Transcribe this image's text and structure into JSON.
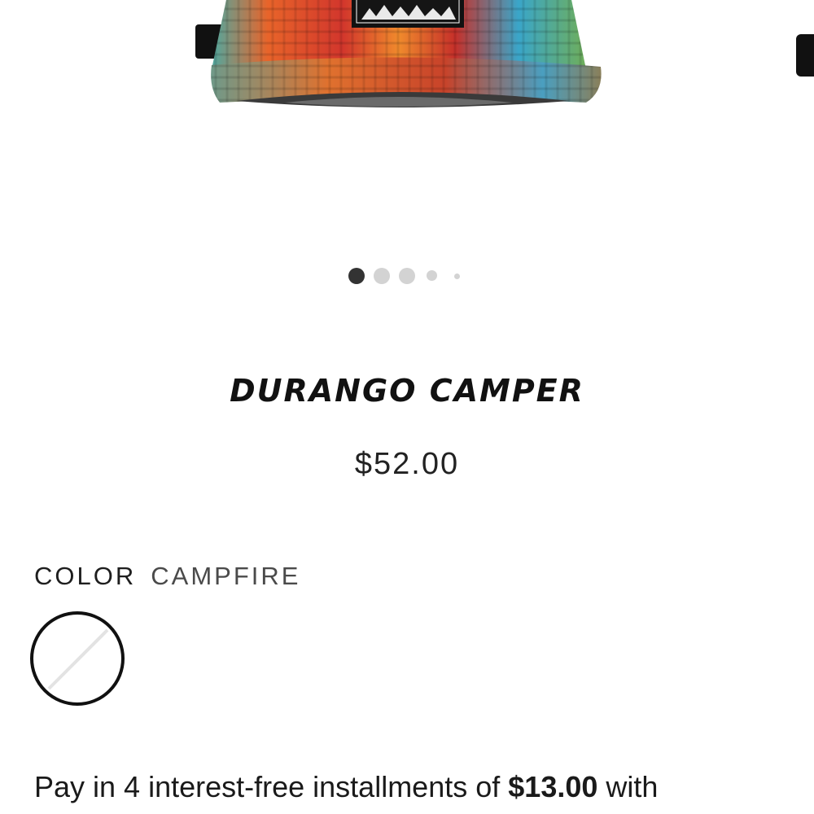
{
  "product": {
    "title": "DURANGO CAMPER",
    "price": "$52.00",
    "hat_image_icon": "plaid-camper-hat-image",
    "gallery_dots_count": 5,
    "gallery_active_index": 0
  },
  "color": {
    "label": "COLOR",
    "selected": "CAMPFIRE"
  },
  "installments": {
    "prefix": "Pay in 4 interest-free installments of",
    "amount": "$13.00",
    "suffix": "with"
  },
  "colors": {
    "plaid_orange": "#e8642a",
    "plaid_red": "#d2362c",
    "plaid_blue": "#3aa6c9",
    "plaid_green": "#6fae5a",
    "dot_active": "#333333",
    "dot_inactive": "#d3d3d3"
  }
}
